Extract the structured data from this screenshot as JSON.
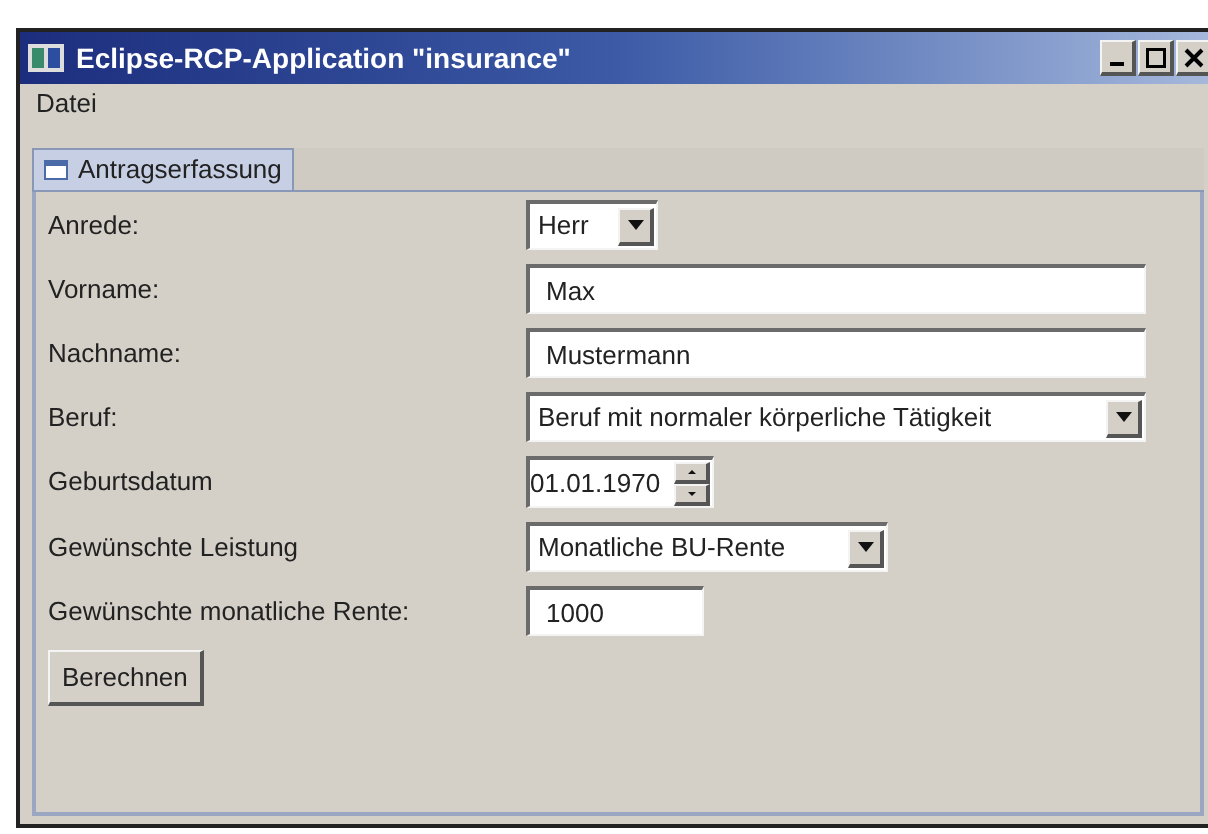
{
  "window": {
    "title": "Eclipse-RCP-Application \"insurance\""
  },
  "menu": [
    "Datei"
  ],
  "tabs": [
    {
      "label": "Antragserfassung",
      "selected": true
    }
  ],
  "form": [
    {
      "label": "Anrede:",
      "kind": "combo",
      "value": "Herr"
    },
    {
      "label": "Vorname:",
      "kind": "text",
      "value": "Max"
    },
    {
      "label": "Nachname:",
      "kind": "text",
      "value": "Mustermann"
    },
    {
      "label": "Beruf:",
      "kind": "combo",
      "value": "Beruf mit normaler körperliche Tätigkeit"
    },
    {
      "label": "Geburtsdatum",
      "kind": "spinner",
      "value": "01.01.1970"
    },
    {
      "label": "Gewünschte Leistung",
      "kind": "combo",
      "value": "Monatliche BU-Rente"
    },
    {
      "label": "Gewünschte monatliche Rente:",
      "kind": "short",
      "value": "1000"
    }
  ],
  "button": "Berechnen"
}
